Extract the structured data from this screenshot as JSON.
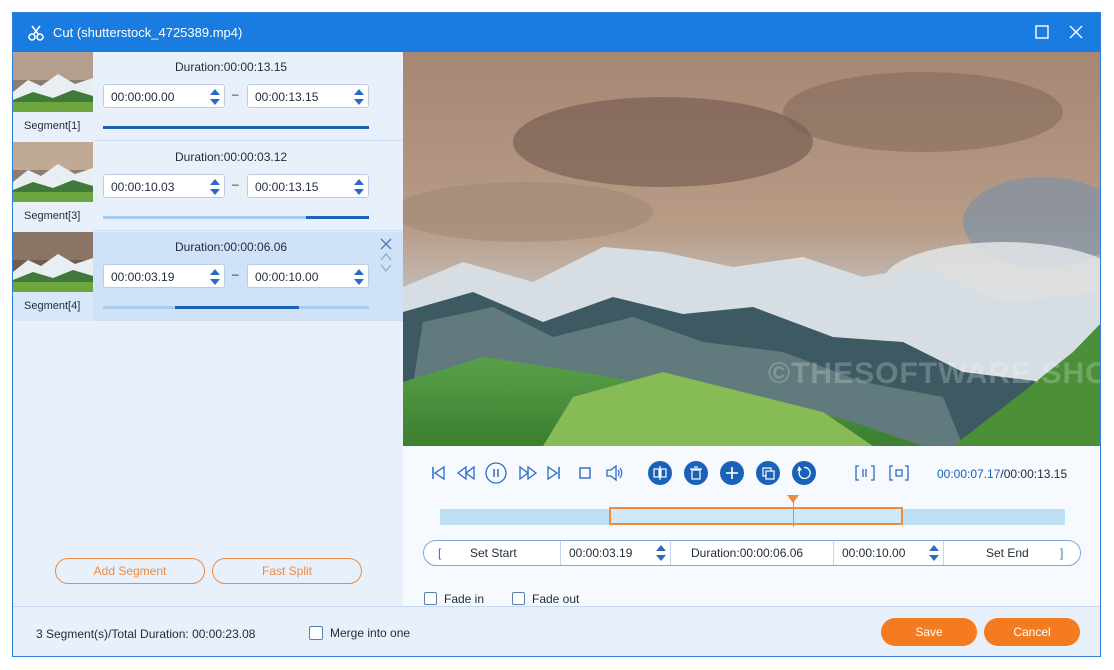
{
  "window": {
    "title": "Cut (shutterstock_4725389.mp4)",
    "accent": "#1a7be0",
    "orange": "#f57b20"
  },
  "segments": [
    {
      "label": "Segment[1]",
      "duration": "Duration:00:00:13.15",
      "start": "00:00:00.00",
      "end": "00:00:13.15",
      "range_start": 0.0,
      "range_end": 1.0
    },
    {
      "label": "Segment[3]",
      "duration": "Duration:00:00:03.12",
      "start": "00:00:10.03",
      "end": "00:00:13.15",
      "range_start": 0.763,
      "range_end": 1.0
    },
    {
      "label": "Segment[4]",
      "duration": "Duration:00:00:06.06",
      "start": "00:00:03.19",
      "end": "00:00:10.00",
      "range_start": 0.27,
      "range_end": 0.735
    }
  ],
  "buttons": {
    "add_segment": "Add Segment",
    "fast_split": "Fast Split",
    "save": "Save",
    "cancel": "Cancel"
  },
  "player": {
    "current_time": "00:00:07.17",
    "separator_total": "/00:00:13.15",
    "watermark": "©THESOFTWARE.SHOP",
    "selection_start": 0.27,
    "selection_end": 0.74,
    "playhead": 0.565
  },
  "trim": {
    "set_start": "Set Start",
    "start_value": "00:00:03.19",
    "duration": "Duration:00:00:06.06",
    "end_value": "00:00:10.00",
    "set_end": "Set End"
  },
  "options": {
    "fade_in": "Fade in",
    "fade_out": "Fade out",
    "merge": "Merge into one"
  },
  "footer": {
    "summary": "3 Segment(s)/Total Duration: 00:00:23.08"
  },
  "icons": [
    "scissors-icon",
    "maximize-icon",
    "close-icon",
    "skip-back-icon",
    "rewind-icon",
    "pause-icon",
    "fast-forward-icon",
    "skip-forward-icon",
    "stop-icon",
    "volume-icon",
    "split-icon",
    "delete-icon",
    "add-icon",
    "copy-icon",
    "reset-icon",
    "set-start-bracket-icon",
    "set-end-bracket-icon"
  ]
}
